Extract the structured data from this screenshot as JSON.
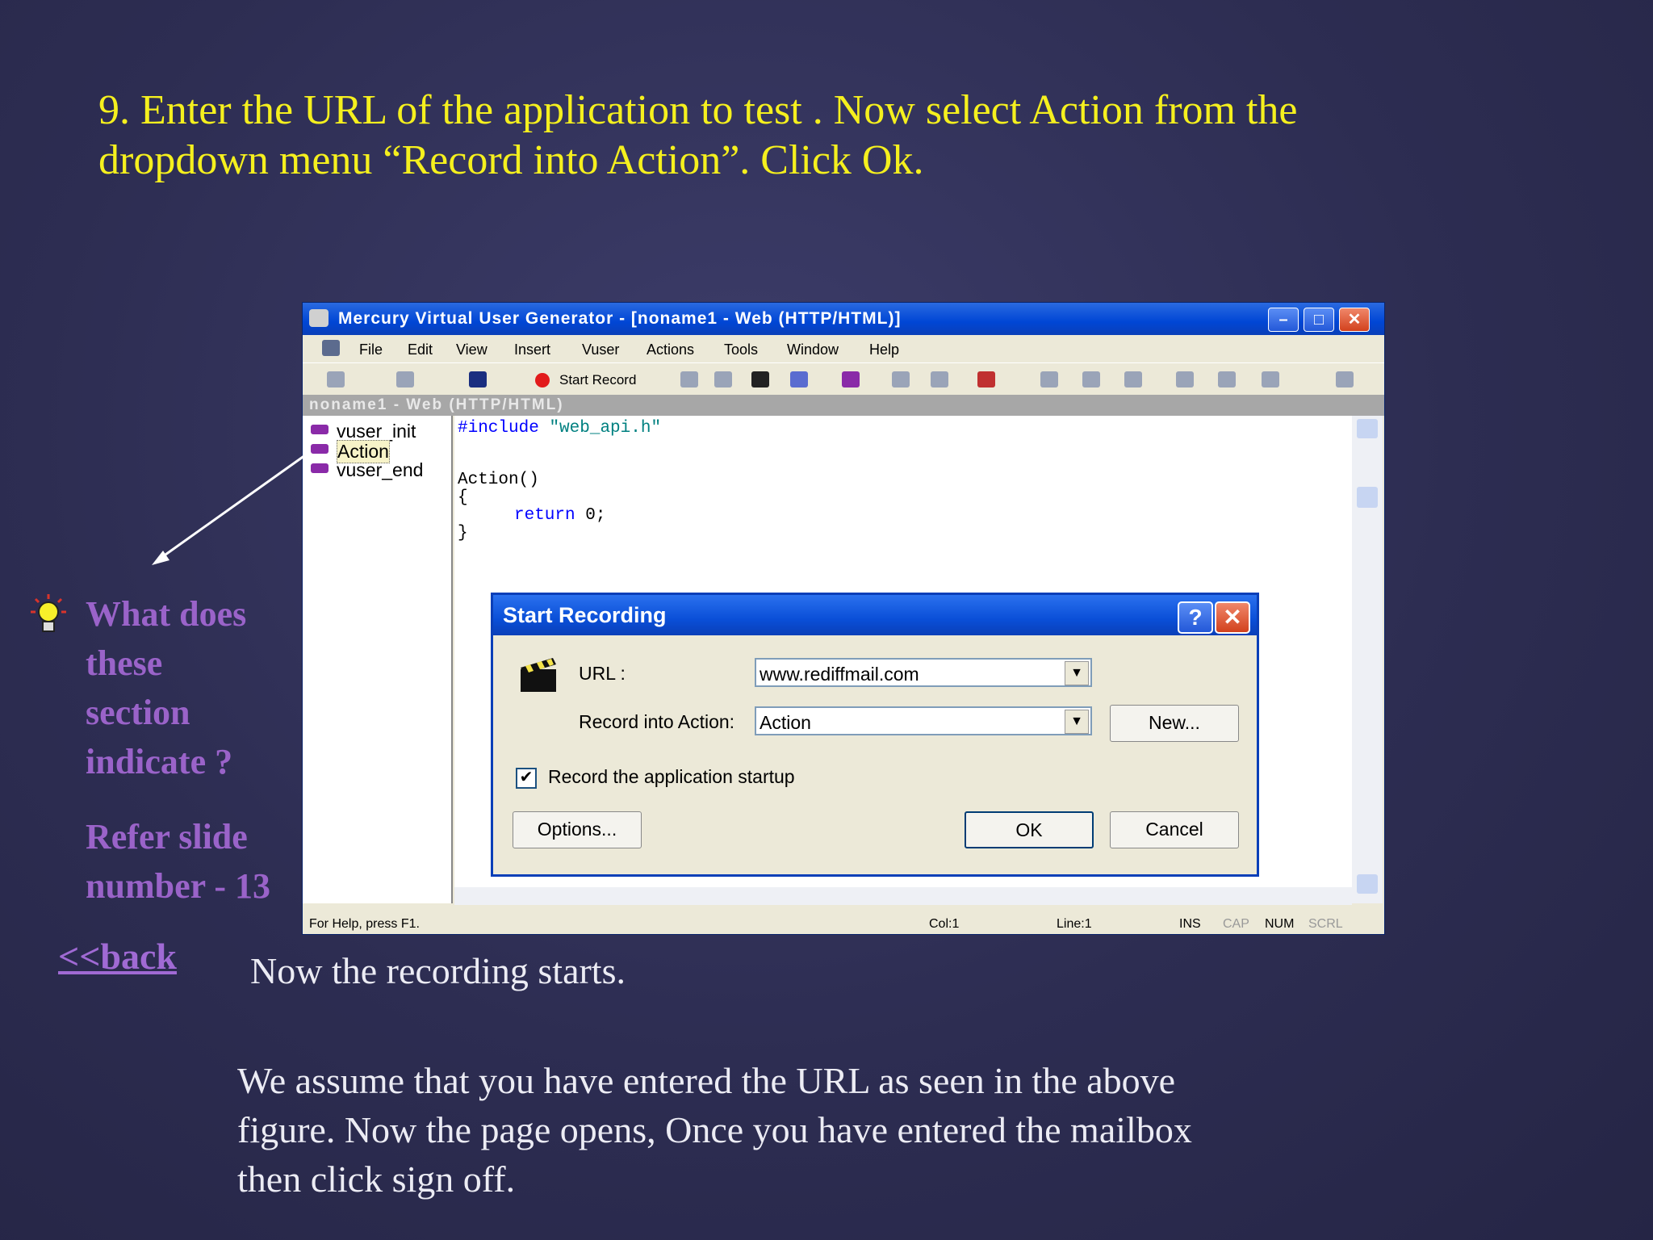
{
  "slide": {
    "title_line1": "9. Enter the URL of the application to test . Now  select Action from the",
    "title_line2": "dropdown menu “Record into Action”. Click Ok.",
    "question_lines": [
      "What does",
      "these",
      "section",
      "indicate ?"
    ],
    "refer_lines": [
      "Refer slide",
      "number - 13"
    ],
    "back_link": "<<back",
    "caption1": "Now the recording starts.",
    "caption2_lines": [
      "We assume that you have entered the URL as seen in the above",
      "figure. Now the  page opens, Once you have entered the mailbox",
      "then click sign off."
    ]
  },
  "window": {
    "title": "Mercury Virtual User Generator - [noname1 - Web (HTTP/HTML)]",
    "menu": [
      "File",
      "Edit",
      "View",
      "Insert",
      "Vuser",
      "Actions",
      "Tools",
      "Window",
      "Help"
    ],
    "toolbar": {
      "start_record": "Start Record"
    },
    "doc_title": "noname1 - Web (HTTP/HTML)",
    "tree": [
      "vuser_init",
      "Action",
      "vuser_end"
    ],
    "code": {
      "include": "#include",
      "include_file": "\"web_api.h\"",
      "action_decl": "Action()",
      "open_brace": "{",
      "return_kw": "return",
      "return_val": "0;",
      "close_brace": "}"
    },
    "status": {
      "help": "For Help, press F1.",
      "col": "Col:1",
      "line": "Line:1",
      "ins": "INS",
      "cap": "CAP",
      "num": "NUM",
      "scrl": "SCRL"
    }
  },
  "dialog": {
    "title": "Start Recording",
    "help": "?",
    "close": "✕",
    "url_label": "URL :",
    "url_value": "www.rediffmail.com",
    "record_label": "Record into Action:",
    "record_value": "Action",
    "new_button": "New...",
    "checkbox_label": "Record the application startup",
    "checkbox_mark": "✔",
    "options_button": "Options...",
    "ok_button": "OK",
    "cancel_button": "Cancel"
  }
}
